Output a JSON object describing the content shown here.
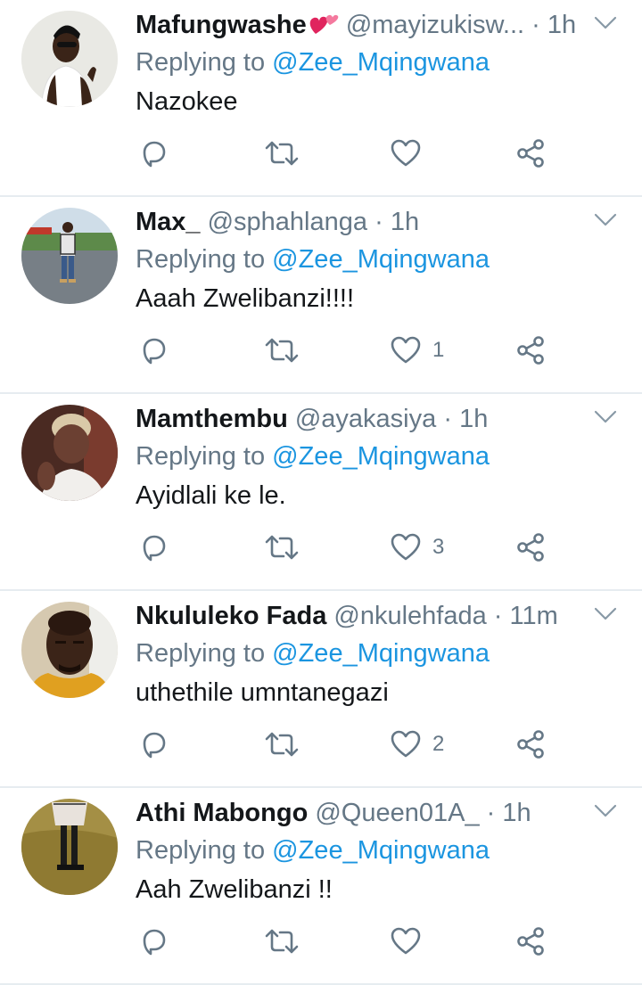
{
  "tweets": [
    {
      "name": "Mafungwashe",
      "handle": "@mayizukisw...",
      "time": "1h",
      "has_emoji": true,
      "replying_label": "Replying to",
      "mention": "@Zee_Mqingwana",
      "text": "Nazokee",
      "like_count": "",
      "avatar_bg": "#f4f4f2"
    },
    {
      "name": "Max_",
      "handle": "@sphahlanga",
      "time": "1h",
      "has_emoji": false,
      "replying_label": "Replying to",
      "mention": "@Zee_Mqingwana",
      "text": "Aaah Zwelibanzi!!!!",
      "like_count": "1",
      "avatar_bg": "#9fb6c9"
    },
    {
      "name": "Mamthembu",
      "handle": "@ayakasiya",
      "time": "1h",
      "has_emoji": false,
      "replying_label": "Replying to",
      "mention": "@Zee_Mqingwana",
      "text": "Ayidlali ke le.",
      "like_count": "3",
      "avatar_bg": "#5a3b30"
    },
    {
      "name": "Nkululeko Fada",
      "handle": "@nkulehfada",
      "time": "11m",
      "has_emoji": false,
      "replying_label": "Replying to",
      "mention": "@Zee_Mqingwana",
      "text": "uthethile umntanegazi",
      "like_count": "2",
      "avatar_bg": "#c9b79a"
    },
    {
      "name": "Athi Mabongo",
      "handle": "@Queen01A_",
      "time": "1h",
      "has_emoji": false,
      "replying_label": "Replying to",
      "mention": "@Zee_Mqingwana",
      "text": "Aah Zwelibanzi !!",
      "like_count": "",
      "avatar_bg": "#a08a3a"
    }
  ],
  "colors": {
    "name": "#14171a",
    "secondary": "#657786",
    "mention": "#1b95e0",
    "divider": "#e6ecf0",
    "emoji_heart": "#e0245e"
  },
  "icons": {
    "reply": "reply-icon",
    "retweet": "retweet-icon",
    "like": "heart-icon",
    "share": "share-icon",
    "menu": "chevron-down-icon"
  }
}
